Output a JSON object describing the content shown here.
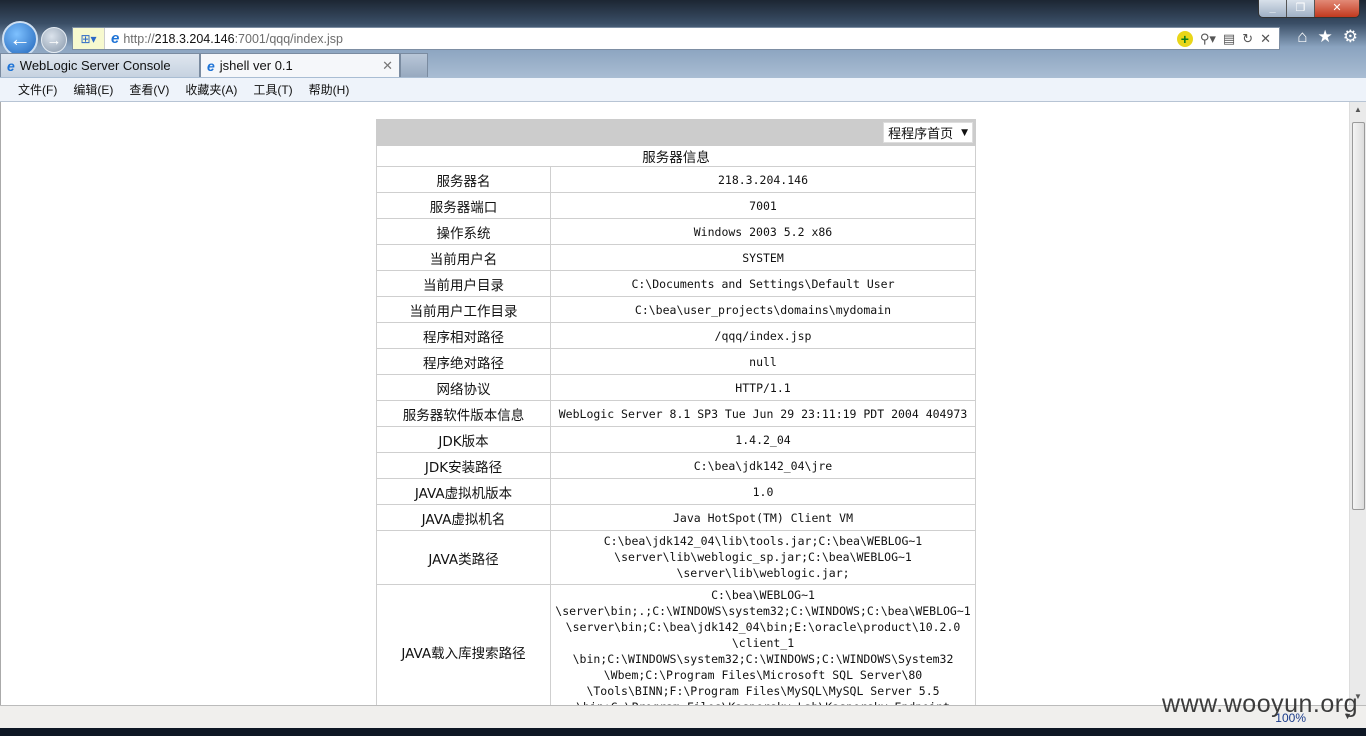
{
  "browser": {
    "url_prefix": "http://",
    "url_host": "218.3.204.146",
    "url_rest": ":7001/qqq/index.jsp",
    "tabs": [
      {
        "label": "WebLogic Server Console",
        "active": false
      },
      {
        "label": "jshell ver 0.1",
        "active": true
      }
    ],
    "menu": [
      "文件(F)",
      "编辑(E)",
      "查看(V)",
      "收藏夹(A)",
      "工具(T)",
      "帮助(H)"
    ],
    "zoom": "100%"
  },
  "page": {
    "nav_select": "程程序首页",
    "title": "服务器信息",
    "rows": [
      {
        "label": "服务器名",
        "value": [
          "218.3.204.146"
        ]
      },
      {
        "label": "服务器端口",
        "value": [
          "7001"
        ]
      },
      {
        "label": "操作系统",
        "value": [
          "Windows 2003 5.2 x86"
        ]
      },
      {
        "label": "当前用户名",
        "value": [
          "SYSTEM"
        ]
      },
      {
        "label": "当前用户目录",
        "value": [
          "C:\\Documents and Settings\\Default User"
        ]
      },
      {
        "label": "当前用户工作目录",
        "value": [
          "C:\\bea\\user_projects\\domains\\mydomain"
        ]
      },
      {
        "label": "程序相对路径",
        "value": [
          "/qqq/index.jsp"
        ]
      },
      {
        "label": "程序绝对路径",
        "value": [
          "null"
        ]
      },
      {
        "label": "网络协议",
        "value": [
          "HTTP/1.1"
        ]
      },
      {
        "label": "服务器软件版本信息",
        "value": [
          "WebLogic Server 8.1 SP3 Tue Jun 29 23:11:19 PDT 2004 404973"
        ]
      },
      {
        "label": "JDK版本",
        "value": [
          "1.4.2_04"
        ]
      },
      {
        "label": "JDK安装路径",
        "value": [
          "C:\\bea\\jdk142_04\\jre"
        ]
      },
      {
        "label": "JAVA虚拟机版本",
        "value": [
          "1.0"
        ]
      },
      {
        "label": "JAVA虚拟机名",
        "value": [
          "Java HotSpot(TM) Client VM"
        ]
      },
      {
        "label": "JAVA类路径",
        "value": [
          "C:\\bea\\jdk142_04\\lib\\tools.jar;C:\\bea\\WEBLOG~1",
          "\\server\\lib\\weblogic_sp.jar;C:\\bea\\WEBLOG~1",
          "\\server\\lib\\weblogic.jar;"
        ]
      },
      {
        "label": "JAVA载入库搜索路径",
        "value": [
          "C:\\bea\\WEBLOG~1",
          "\\server\\bin;.;C:\\WINDOWS\\system32;C:\\WINDOWS;C:\\bea\\WEBLOG~1",
          "\\server\\bin;C:\\bea\\jdk142_04\\bin;E:\\oracle\\product\\10.2.0",
          "\\client_1",
          "\\bin;C:\\WINDOWS\\system32;C:\\WINDOWS;C:\\WINDOWS\\System32",
          "\\Wbem;C:\\Program Files\\Microsoft SQL Server\\80",
          "\\Tools\\BINN;F:\\Program Files\\MySQL\\MySQL Server 5.5",
          "\\bin;C:\\Program Files\\Kaspersky Lab\\Kaspersky Endpoint"
        ]
      }
    ]
  },
  "watermark": "www.wooyun.org"
}
